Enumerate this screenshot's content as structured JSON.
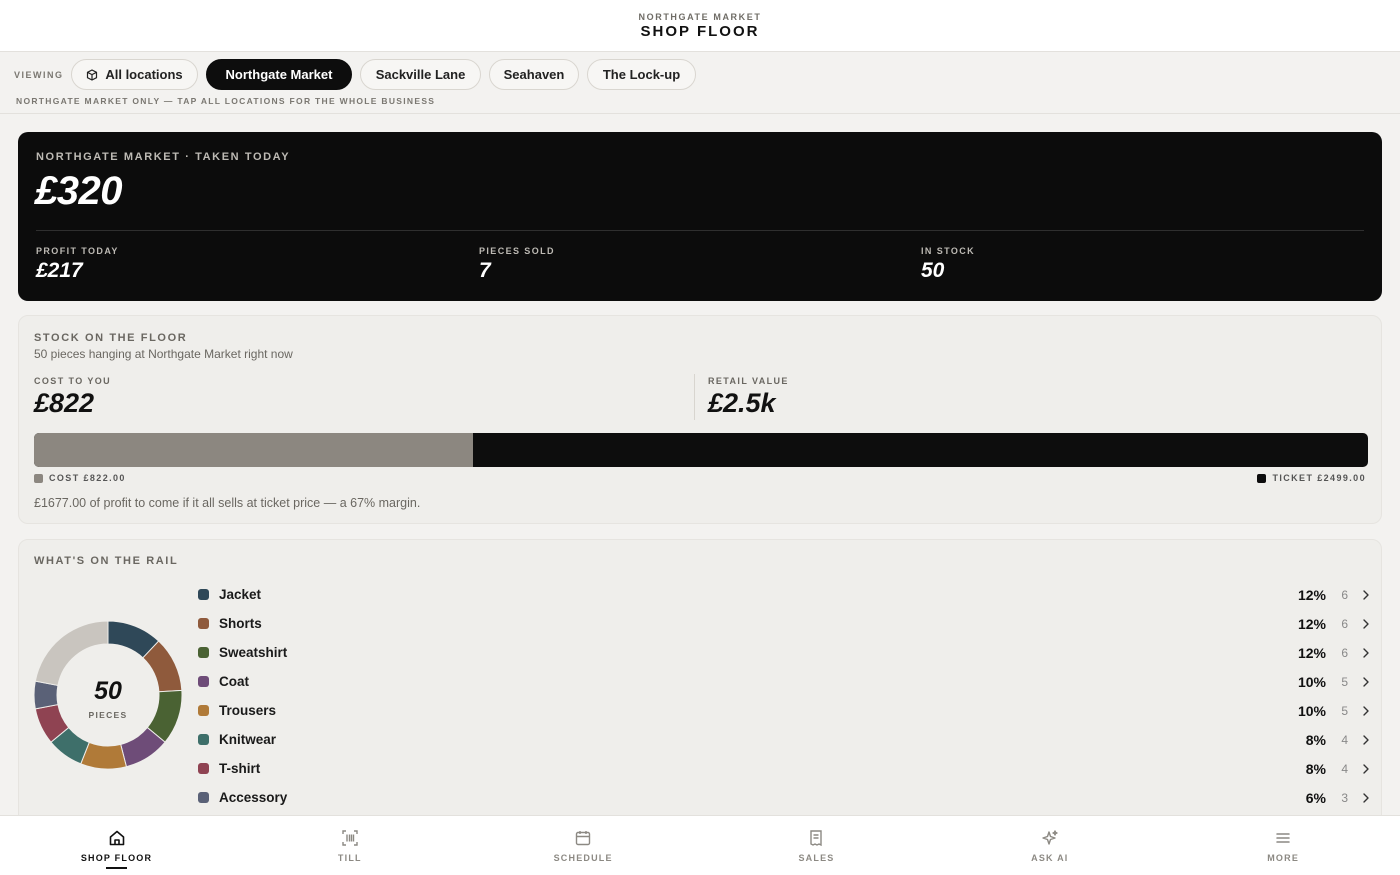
{
  "header": {
    "kicker": "NORTHGATE MARKET",
    "title": "SHOP FLOOR"
  },
  "viewing": {
    "label": "VIEWING",
    "chips": [
      {
        "label": "All locations",
        "icon": "box-icon",
        "active": false
      },
      {
        "label": "Northgate Market",
        "active": true
      },
      {
        "label": "Sackville Lane",
        "active": false
      },
      {
        "label": "Seahaven",
        "active": false
      },
      {
        "label": "The Lock-up",
        "active": false
      }
    ],
    "note": "NORTHGATE MARKET ONLY — TAP ALL LOCATIONS FOR THE WHOLE BUSINESS"
  },
  "hero": {
    "label": "NORTHGATE MARKET · TAKEN TODAY",
    "value": "£320",
    "stats": [
      {
        "label": "PROFIT TODAY",
        "value": "£217"
      },
      {
        "label": "PIECES SOLD",
        "value": "7"
      },
      {
        "label": "IN STOCK",
        "value": "50"
      }
    ]
  },
  "stock": {
    "title": "STOCK ON THE FLOOR",
    "subtitle": "50 pieces hanging at Northgate Market right now",
    "cost_label": "COST TO YOU",
    "cost_value": "£822",
    "retail_label": "RETAIL VALUE",
    "retail_value": "£2.5k",
    "cost_fraction": 0.329,
    "legend_cost": "COST £822.00",
    "legend_ticket": "TICKET £2499.00",
    "note": "£1677.00 of profit to come if it all sells at ticket price — a 67% margin.",
    "colors": {
      "cost": "#8c8780",
      "ticket": "#0d0d0d"
    }
  },
  "rail": {
    "title": "WHAT'S ON THE RAIL",
    "total": "50",
    "total_caption": "PIECES",
    "items": [
      {
        "name": "Jacket",
        "pct": "12%",
        "count": "6",
        "color": "#2f4858"
      },
      {
        "name": "Shorts",
        "pct": "12%",
        "count": "6",
        "color": "#8f5a3c"
      },
      {
        "name": "Sweatshirt",
        "pct": "12%",
        "count": "6",
        "color": "#4a6233"
      },
      {
        "name": "Coat",
        "pct": "10%",
        "count": "5",
        "color": "#6e4c78"
      },
      {
        "name": "Trousers",
        "pct": "10%",
        "count": "5",
        "color": "#b07a38"
      },
      {
        "name": "Knitwear",
        "pct": "8%",
        "count": "4",
        "color": "#3e6f6a"
      },
      {
        "name": "T-shirt",
        "pct": "8%",
        "count": "4",
        "color": "#8f4352"
      },
      {
        "name": "Accessory",
        "pct": "6%",
        "count": "3",
        "color": "#5a6177"
      }
    ]
  },
  "nav": [
    {
      "label": "SHOP FLOOR",
      "icon": "home-icon",
      "active": true
    },
    {
      "label": "TILL",
      "icon": "barcode-scan-icon",
      "active": false
    },
    {
      "label": "SCHEDULE",
      "icon": "calendar-icon",
      "active": false
    },
    {
      "label": "SALES",
      "icon": "receipt-icon",
      "active": false
    },
    {
      "label": "ASK AI",
      "icon": "sparkle-icon",
      "active": false
    },
    {
      "label": "MORE",
      "icon": "menu-icon",
      "active": false
    }
  ]
}
